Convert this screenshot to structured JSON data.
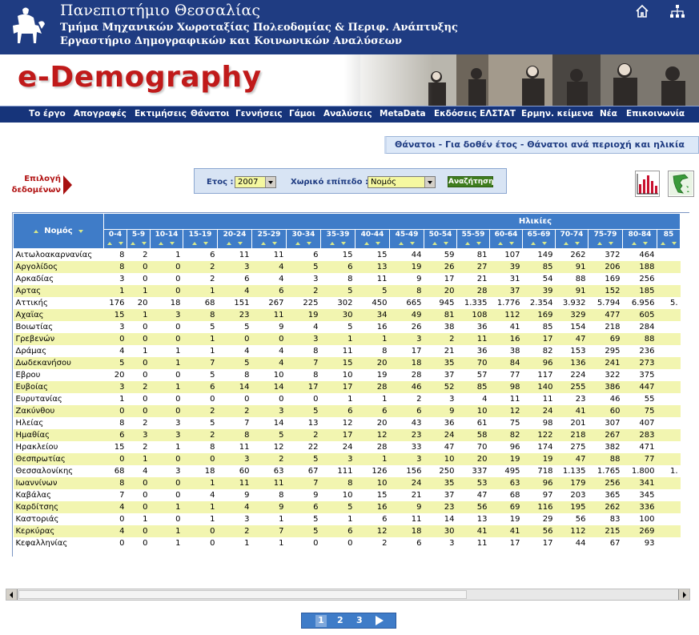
{
  "header": {
    "university": "Πανεπιστήμιο Θεσσαλίας",
    "department": "Τμήμα Μηχανικών Χωροταξίας Πολεοδομίας & Περιφ. Ανάπτυξης",
    "lab": "Εργαστήριο Δημογραφικών και Κοινωνικών Αναλύσεων",
    "home_icon": "home-icon",
    "sitemap_icon": "sitemap-icon"
  },
  "banner": {
    "title": "e-Demography"
  },
  "menu": [
    "Το έργο",
    "Απογραφές",
    "Εκτιμήσεις",
    "Θάνατοι",
    "Γεννήσεις",
    "Γάμοι",
    "Αναλύσεις",
    "MetaData",
    "Εκδόσεις ΕΛΣΤΑΤ",
    "Ερμην. κείμενα",
    "Νέα",
    "Επικοινωνία"
  ],
  "page_title": "Θάνατοι - Για δοθέν έτος - Θάνατοι ανά περιοχή και ηλικία",
  "data_select": {
    "label": "Επιλογή δεδομένων"
  },
  "filters": {
    "year_label": "Ετος :",
    "year_value": "2007",
    "level_label": "Χωρικό επίπεδο :",
    "level_value": "Νομός",
    "search_label": "Αναζήτηση"
  },
  "actions": {
    "chart_icon": "bar-chart-icon",
    "map_icon": "greece-map-icon"
  },
  "table": {
    "region_header": "Νομός",
    "group_header": "Ηλικίες",
    "age_groups": [
      "0-4",
      "5-9",
      "10-14",
      "15-19",
      "20-24",
      "25-29",
      "30-34",
      "35-39",
      "40-44",
      "45-49",
      "50-54",
      "55-59",
      "60-64",
      "65-69",
      "70-74",
      "75-79",
      "80-84",
      "85"
    ],
    "rows": [
      {
        "name": "Αιτωλοακαρνανίας",
        "v": [
          "8",
          "2",
          "1",
          "6",
          "11",
          "11",
          "6",
          "15",
          "15",
          "44",
          "59",
          "81",
          "107",
          "149",
          "262",
          "372",
          "464",
          ""
        ]
      },
      {
        "name": "Αργολίδος",
        "v": [
          "8",
          "0",
          "0",
          "2",
          "3",
          "4",
          "5",
          "6",
          "13",
          "19",
          "26",
          "27",
          "39",
          "85",
          "91",
          "206",
          "188",
          ""
        ]
      },
      {
        "name": "Αρκαδίας",
        "v": [
          "3",
          "0",
          "0",
          "2",
          "6",
          "4",
          "3",
          "8",
          "11",
          "9",
          "17",
          "21",
          "31",
          "54",
          "88",
          "169",
          "256",
          ""
        ]
      },
      {
        "name": "Αρτας",
        "v": [
          "1",
          "1",
          "0",
          "1",
          "4",
          "6",
          "2",
          "5",
          "5",
          "8",
          "20",
          "28",
          "37",
          "39",
          "91",
          "152",
          "185",
          ""
        ]
      },
      {
        "name": "Αττικής",
        "v": [
          "176",
          "20",
          "18",
          "68",
          "151",
          "267",
          "225",
          "302",
          "450",
          "665",
          "945",
          "1.335",
          "1.776",
          "2.354",
          "3.932",
          "5.794",
          "6.956",
          "5."
        ]
      },
      {
        "name": "Αχαϊας",
        "v": [
          "15",
          "1",
          "3",
          "8",
          "23",
          "11",
          "19",
          "30",
          "34",
          "49",
          "81",
          "108",
          "112",
          "169",
          "329",
          "477",
          "605",
          ""
        ]
      },
      {
        "name": "Βοιωτίας",
        "v": [
          "3",
          "0",
          "0",
          "5",
          "5",
          "9",
          "4",
          "5",
          "16",
          "26",
          "38",
          "36",
          "41",
          "85",
          "154",
          "218",
          "284",
          ""
        ]
      },
      {
        "name": "Γρεβενών",
        "v": [
          "0",
          "0",
          "0",
          "1",
          "0",
          "0",
          "3",
          "1",
          "1",
          "3",
          "2",
          "11",
          "16",
          "17",
          "47",
          "69",
          "88",
          ""
        ]
      },
      {
        "name": "Δράμας",
        "v": [
          "4",
          "1",
          "1",
          "1",
          "4",
          "4",
          "8",
          "11",
          "8",
          "17",
          "21",
          "36",
          "38",
          "82",
          "153",
          "295",
          "236",
          ""
        ]
      },
      {
        "name": "Δωδεκανήσου",
        "v": [
          "5",
          "0",
          "1",
          "7",
          "5",
          "4",
          "7",
          "15",
          "20",
          "18",
          "35",
          "70",
          "84",
          "96",
          "136",
          "241",
          "273",
          ""
        ]
      },
      {
        "name": "Εβρου",
        "v": [
          "20",
          "0",
          "0",
          "5",
          "8",
          "10",
          "8",
          "10",
          "19",
          "28",
          "37",
          "57",
          "77",
          "117",
          "224",
          "322",
          "375",
          ""
        ]
      },
      {
        "name": "Ευβοίας",
        "v": [
          "3",
          "2",
          "1",
          "6",
          "14",
          "14",
          "17",
          "17",
          "28",
          "46",
          "52",
          "85",
          "98",
          "140",
          "255",
          "386",
          "447",
          ""
        ]
      },
      {
        "name": "Ευρυτανίας",
        "v": [
          "1",
          "0",
          "0",
          "0",
          "0",
          "0",
          "0",
          "1",
          "1",
          "2",
          "3",
          "4",
          "11",
          "11",
          "23",
          "46",
          "55",
          ""
        ]
      },
      {
        "name": "Ζακύνθου",
        "v": [
          "0",
          "0",
          "0",
          "2",
          "2",
          "3",
          "5",
          "6",
          "6",
          "6",
          "9",
          "10",
          "12",
          "24",
          "41",
          "60",
          "75",
          ""
        ]
      },
      {
        "name": "Ηλείας",
        "v": [
          "8",
          "2",
          "3",
          "5",
          "7",
          "14",
          "13",
          "12",
          "20",
          "43",
          "36",
          "61",
          "75",
          "98",
          "201",
          "307",
          "407",
          ""
        ]
      },
      {
        "name": "Ημαθίας",
        "v": [
          "6",
          "3",
          "3",
          "2",
          "8",
          "5",
          "2",
          "17",
          "12",
          "23",
          "24",
          "58",
          "82",
          "122",
          "218",
          "267",
          "283",
          ""
        ]
      },
      {
        "name": "Ηρακλείου",
        "v": [
          "15",
          "2",
          "1",
          "8",
          "11",
          "12",
          "22",
          "24",
          "28",
          "33",
          "47",
          "70",
          "96",
          "174",
          "275",
          "382",
          "471",
          ""
        ]
      },
      {
        "name": "Θεσπρωτίας",
        "v": [
          "0",
          "1",
          "0",
          "0",
          "3",
          "2",
          "5",
          "3",
          "1",
          "3",
          "10",
          "20",
          "19",
          "19",
          "47",
          "88",
          "77",
          ""
        ]
      },
      {
        "name": "Θεσσαλονίκης",
        "v": [
          "68",
          "4",
          "3",
          "18",
          "60",
          "63",
          "67",
          "111",
          "126",
          "156",
          "250",
          "337",
          "495",
          "718",
          "1.135",
          "1.765",
          "1.800",
          "1."
        ]
      },
      {
        "name": "Ιωαννίνων",
        "v": [
          "8",
          "0",
          "0",
          "1",
          "11",
          "11",
          "7",
          "8",
          "10",
          "24",
          "35",
          "53",
          "63",
          "96",
          "179",
          "256",
          "341",
          ""
        ]
      },
      {
        "name": "Καβάλας",
        "v": [
          "7",
          "0",
          "0",
          "4",
          "9",
          "8",
          "9",
          "10",
          "15",
          "21",
          "37",
          "47",
          "68",
          "97",
          "203",
          "365",
          "345",
          ""
        ]
      },
      {
        "name": "Καρδίτσης",
        "v": [
          "4",
          "0",
          "1",
          "1",
          "4",
          "9",
          "6",
          "5",
          "16",
          "9",
          "23",
          "56",
          "69",
          "116",
          "195",
          "262",
          "336",
          ""
        ]
      },
      {
        "name": "Καστοριάς",
        "v": [
          "0",
          "1",
          "0",
          "1",
          "3",
          "1",
          "5",
          "1",
          "6",
          "11",
          "14",
          "13",
          "19",
          "29",
          "56",
          "83",
          "100",
          ""
        ]
      },
      {
        "name": "Κερκύρας",
        "v": [
          "4",
          "0",
          "1",
          "0",
          "2",
          "7",
          "5",
          "6",
          "12",
          "18",
          "30",
          "41",
          "41",
          "56",
          "112",
          "215",
          "269",
          ""
        ]
      },
      {
        "name": "Κεφαλληνίας",
        "v": [
          "0",
          "0",
          "1",
          "0",
          "1",
          "1",
          "0",
          "0",
          "2",
          "6",
          "3",
          "11",
          "17",
          "17",
          "44",
          "67",
          "93",
          ""
        ]
      }
    ]
  },
  "pagination": {
    "pages": [
      "1",
      "2",
      "3"
    ],
    "current": "1",
    "next_icon": "next-arrow-icon"
  }
}
